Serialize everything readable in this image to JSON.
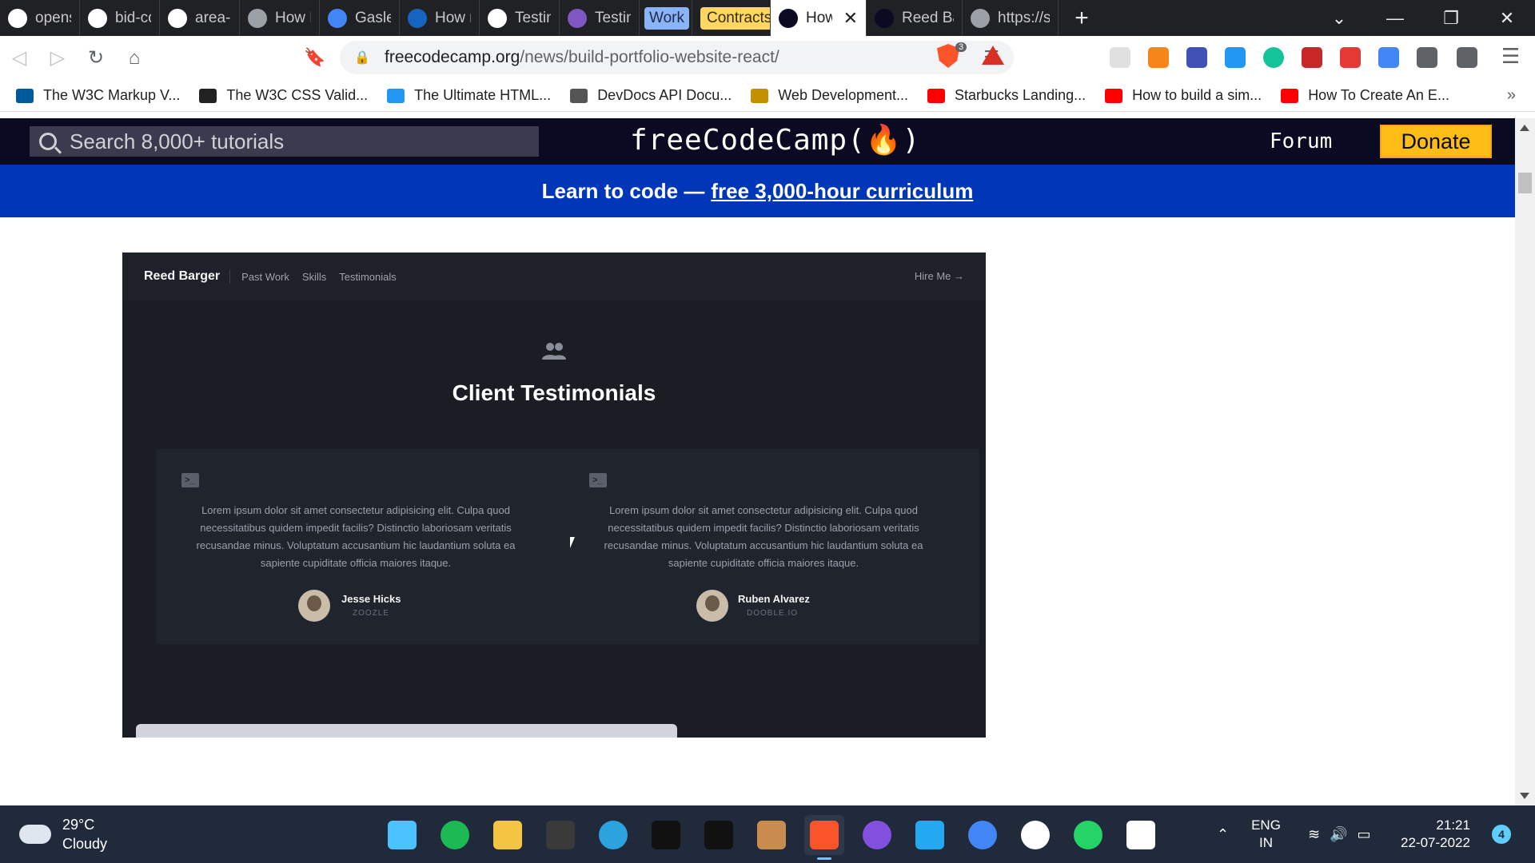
{
  "browser": {
    "tabs": [
      {
        "label": "opensea",
        "icon": "github-icon",
        "color": "#ffffff"
      },
      {
        "label": "bid-cont",
        "icon": "github-icon",
        "color": "#ffffff"
      },
      {
        "label": "area-eth",
        "icon": "github-icon",
        "color": "#ffffff"
      },
      {
        "label": "How Me",
        "icon": "globe-icon",
        "color": "#9aa0a6"
      },
      {
        "label": "Gasless",
        "icon": "google-docs-icon",
        "color": "#4285f4"
      },
      {
        "label": "How mu",
        "icon": "fe-icon",
        "color": "#1565c0"
      },
      {
        "label": "Testing",
        "icon": "notion-icon",
        "color": "#ffffff"
      },
      {
        "label": "Testing",
        "icon": "alchemy-icon",
        "color": "#7e57c2"
      }
    ],
    "tab_groups": {
      "work": "Work",
      "contracts": "Contracts"
    },
    "active_tab": {
      "label": "How",
      "icon": "freecodecamp-icon"
    },
    "tabs_after": [
      {
        "label": "Reed Ba",
        "icon": "freecodecamp-icon"
      },
      {
        "label": "https://s",
        "icon": "globe-icon"
      }
    ],
    "url_domain": "freecodecamp.org",
    "url_path": "/news/build-portfolio-website-react/",
    "shield_count": "3",
    "bookmarks": [
      {
        "label": "The W3C Markup V...",
        "icon": "w3c-icon",
        "color": "#005a9c"
      },
      {
        "label": "The W3C CSS Valid...",
        "icon": "w3c-css-icon",
        "color": "#222222"
      },
      {
        "label": "The Ultimate HTML...",
        "icon": "html-icon",
        "color": "#2196f3"
      },
      {
        "label": "DevDocs API Docu...",
        "icon": "devdocs-icon",
        "color": "#555555"
      },
      {
        "label": "Web Development...",
        "icon": "web-dev-icon",
        "color": "#c49000"
      },
      {
        "label": "Starbucks Landing...",
        "icon": "youtube-icon",
        "color": "#ff0000"
      },
      {
        "label": "How to build a sim...",
        "icon": "youtube-icon",
        "color": "#ff0000"
      },
      {
        "label": "How To Create An E...",
        "icon": "youtube-icon",
        "color": "#ff0000"
      }
    ],
    "bookmarks_more": "»"
  },
  "fcc": {
    "search_placeholder": "Search 8,000+ tutorials",
    "logo": "freeCodeCamp(🔥)",
    "forum": "Forum",
    "donate": "Donate",
    "banner_prefix": "Learn to code —",
    "banner_link": "free 3,000-hour curriculum"
  },
  "embedded": {
    "brand": "Reed Barger",
    "links": [
      "Past Work",
      "Skills",
      "Testimonials"
    ],
    "hire": "Hire Me →",
    "heading": "Client Testimonials",
    "testimonials": [
      {
        "quote": "Lorem ipsum dolor sit amet consectetur adipisicing elit. Culpa quod necessitatibus quidem impedit facilis? Distinctio laboriosam veritatis recusandae minus. Voluptatum accusantium hic laudantium soluta ea sapiente cupiditate officia maiores itaque.",
        "name": "Jesse Hicks",
        "company": "ZOOZLE"
      },
      {
        "quote": "Lorem ipsum dolor sit amet consectetur adipisicing elit. Culpa quod necessitatibus quidem impedit facilis? Distinctio laboriosam veritatis recusandae minus. Voluptatum accusantium hic laudantium soluta ea sapiente cupiditate officia maiores itaque.",
        "name": "Ruben Alvarez",
        "company": "DOOBLE.IO"
      }
    ]
  },
  "taskbar": {
    "temperature": "29°C",
    "condition": "Cloudy",
    "apps": [
      {
        "icon": "windows-start-icon",
        "color": "#4cc2ff"
      },
      {
        "icon": "spotify-icon",
        "color": "#1db954"
      },
      {
        "icon": "file-explorer-icon",
        "color": "#f4c542"
      },
      {
        "icon": "speedometer-icon",
        "color": "#3a3a3a"
      },
      {
        "icon": "telegram-icon",
        "color": "#2aa3df"
      },
      {
        "icon": "terminal-icon",
        "color": "#111111"
      },
      {
        "icon": "netflix-icon",
        "color": "#111111"
      },
      {
        "icon": "package-icon",
        "color": "#c98b4e"
      },
      {
        "icon": "brave-icon",
        "color": "#fb542b"
      },
      {
        "icon": "github-desktop-icon",
        "color": "#8250df"
      },
      {
        "icon": "vscode-icon",
        "color": "#23a9f2"
      },
      {
        "icon": "chrome-icon",
        "color": "#4285f4"
      },
      {
        "icon": "mongodb-compass-icon",
        "color": "#ffffff"
      },
      {
        "icon": "whatsapp-icon",
        "color": "#25d366"
      },
      {
        "icon": "slack-icon",
        "color": "#ffffff"
      }
    ],
    "lang_line1": "ENG",
    "lang_line2": "IN",
    "time": "21:21",
    "date": "22-07-2022",
    "notifications": "4"
  }
}
